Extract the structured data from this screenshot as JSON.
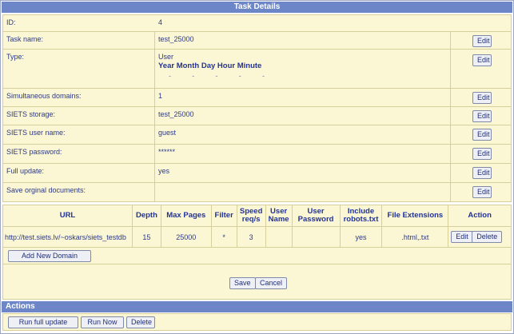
{
  "title": "Task Details",
  "fields": {
    "id": {
      "label": "ID:",
      "value": "4"
    },
    "task_name": {
      "label": "Task name:",
      "value": "test_25000"
    },
    "type": {
      "label": "Type:",
      "value": "User",
      "schedule_header": "Year Month Day Hour Minute",
      "schedule_values": [
        "-",
        "-",
        "-",
        "-",
        "-"
      ]
    },
    "simultaneous_domains": {
      "label": "Simultaneous domains:",
      "value": "1"
    },
    "siets_storage": {
      "label": "SIETS storage:",
      "value": "test_25000"
    },
    "siets_user_name": {
      "label": "SIETS user name:",
      "value": "guest"
    },
    "siets_password": {
      "label": "SIETS password:",
      "value": "******"
    },
    "full_update": {
      "label": "Full update:",
      "value": "yes"
    },
    "save_original": {
      "label": "Save orginal documents:",
      "value": ""
    }
  },
  "edit_label": "Edit",
  "domains": {
    "columns": [
      "URL",
      "Depth",
      "Max Pages",
      "Filter",
      "Speed req/s",
      "User Name",
      "User Password",
      "Include robots.txt",
      "File Extensions",
      "Action"
    ],
    "rows": [
      {
        "url": "http://test.siets.lv/~oskars/siets_testdb",
        "depth": "15",
        "max_pages": "25000",
        "filter": "*",
        "speed": "3",
        "user_name": "",
        "user_password": "",
        "robots": "yes",
        "extensions": ".html,.txt"
      }
    ],
    "edit_label": "Edit",
    "delete_label": "Delete",
    "add_label": "Add New Domain"
  },
  "form": {
    "save_label": "Save",
    "cancel_label": "Cancel"
  },
  "actions": {
    "title": "Actions",
    "run_full_update": "Run full update",
    "run_now": "Run Now",
    "delete": "Delete"
  }
}
